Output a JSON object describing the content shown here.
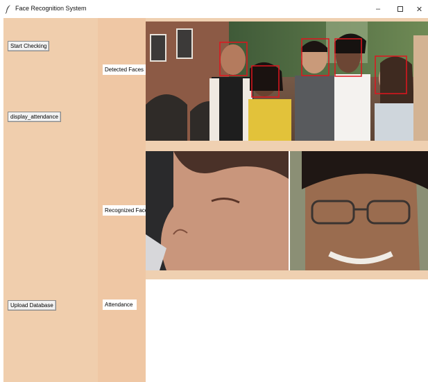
{
  "window": {
    "title": "Face Recognition System",
    "controls": {
      "minimize": "–",
      "close": "✕"
    },
    "icon": "feather-icon"
  },
  "left_panel": {
    "buttons": {
      "start_checking": "Start Checking",
      "display_attendance": "display_attendance",
      "upload_database": "Upload Database"
    }
  },
  "mid_panel": {
    "labels": {
      "detected_faces": "Detected Faces",
      "recognized_faces": "Recognized Faces",
      "attendance": "Attendance"
    }
  },
  "images": {
    "detected": "group-photo",
    "recognized": [
      "face-crop-woman",
      "face-crop-man"
    ]
  },
  "colors": {
    "left_panel": "#f0cead",
    "mid_panel": "#efc7a4",
    "face_box": "#e0141e"
  }
}
